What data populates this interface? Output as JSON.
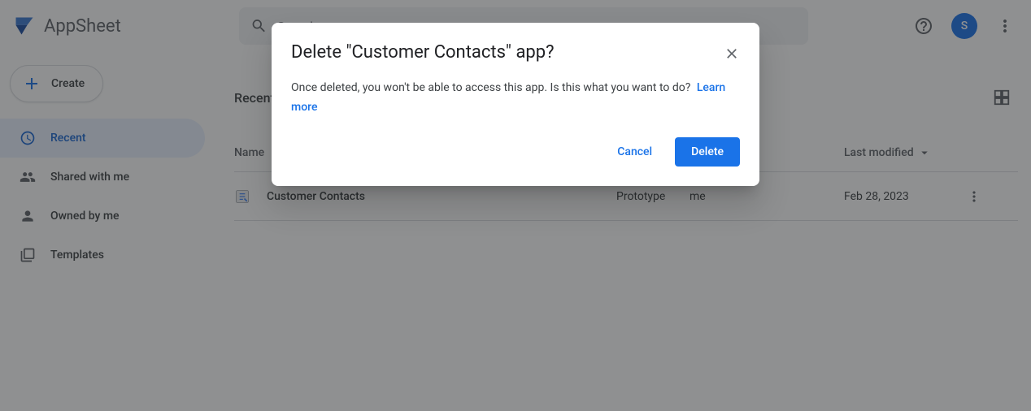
{
  "header": {
    "logo_text": "AppSheet",
    "search_placeholder": "Search",
    "avatar_initial": "S"
  },
  "sidebar": {
    "create_label": "Create",
    "items": [
      {
        "label": "Recent"
      },
      {
        "label": "Shared with me"
      },
      {
        "label": "Owned by me"
      },
      {
        "label": "Templates"
      }
    ]
  },
  "main": {
    "section_title": "Recent",
    "columns": {
      "name": "Name",
      "modified": "Last modified"
    },
    "rows": [
      {
        "name": "Customer Contacts",
        "status": "Prototype",
        "owner": "me",
        "modified": "Feb 28, 2023"
      }
    ]
  },
  "dialog": {
    "title": "Delete \"Customer Contacts\" app?",
    "body": "Once deleted, you won't be able to access this app. Is this what you want to do?",
    "learn_more": "Learn more",
    "cancel": "Cancel",
    "delete": "Delete"
  }
}
